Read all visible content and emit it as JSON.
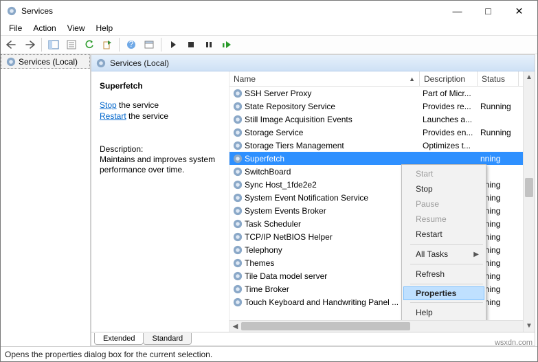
{
  "window": {
    "title": "Services"
  },
  "menu": {
    "file": "File",
    "action": "Action",
    "view": "View",
    "help": "Help"
  },
  "tree": {
    "root": "Services (Local)"
  },
  "header": {
    "title": "Services (Local)"
  },
  "detail": {
    "name": "Superfetch",
    "stop_link": "Stop",
    "stop_rest": "the service",
    "restart_link": "Restart",
    "restart_rest": "the service",
    "desc_label": "Description:",
    "desc": "Maintains and improves system performance over time."
  },
  "columns": {
    "name": "Name",
    "description": "Description",
    "status": "Status"
  },
  "rows": [
    {
      "name": "SSH Server Proxy",
      "desc": "Part of Micr...",
      "status": ""
    },
    {
      "name": "State Repository Service",
      "desc": "Provides re...",
      "status": "Running"
    },
    {
      "name": "Still Image Acquisition Events",
      "desc": "Launches a...",
      "status": ""
    },
    {
      "name": "Storage Service",
      "desc": "Provides en...",
      "status": "Running"
    },
    {
      "name": "Storage Tiers Management",
      "desc": "Optimizes t...",
      "status": ""
    },
    {
      "name": "Superfetch",
      "desc": "",
      "status": "nning"
    },
    {
      "name": "SwitchBoard",
      "desc": "",
      "status": ""
    },
    {
      "name": "Sync Host_1fde2e2",
      "desc": "",
      "status": "nning"
    },
    {
      "name": "System Event Notification Service",
      "desc": "",
      "status": "nning"
    },
    {
      "name": "System Events Broker",
      "desc": "",
      "status": "nning"
    },
    {
      "name": "Task Scheduler",
      "desc": "",
      "status": "nning"
    },
    {
      "name": "TCP/IP NetBIOS Helper",
      "desc": "",
      "status": "nning"
    },
    {
      "name": "Telephony",
      "desc": "",
      "status": "nning"
    },
    {
      "name": "Themes",
      "desc": "",
      "status": "nning"
    },
    {
      "name": "Tile Data model server",
      "desc": "",
      "status": "nning"
    },
    {
      "name": "Time Broker",
      "desc": "",
      "status": "nning"
    },
    {
      "name": "Touch Keyboard and Handwriting Panel ...",
      "desc": "",
      "status": "nning"
    }
  ],
  "selected_index": 5,
  "ctx": {
    "start": "Start",
    "stop": "Stop",
    "pause": "Pause",
    "resume": "Resume",
    "restart": "Restart",
    "all_tasks": "All Tasks",
    "refresh": "Refresh",
    "properties": "Properties",
    "help": "Help"
  },
  "tabs": {
    "extended": "Extended",
    "standard": "Standard"
  },
  "status": "Opens the properties dialog box for the current selection.",
  "watermark": "wsxdn.com"
}
